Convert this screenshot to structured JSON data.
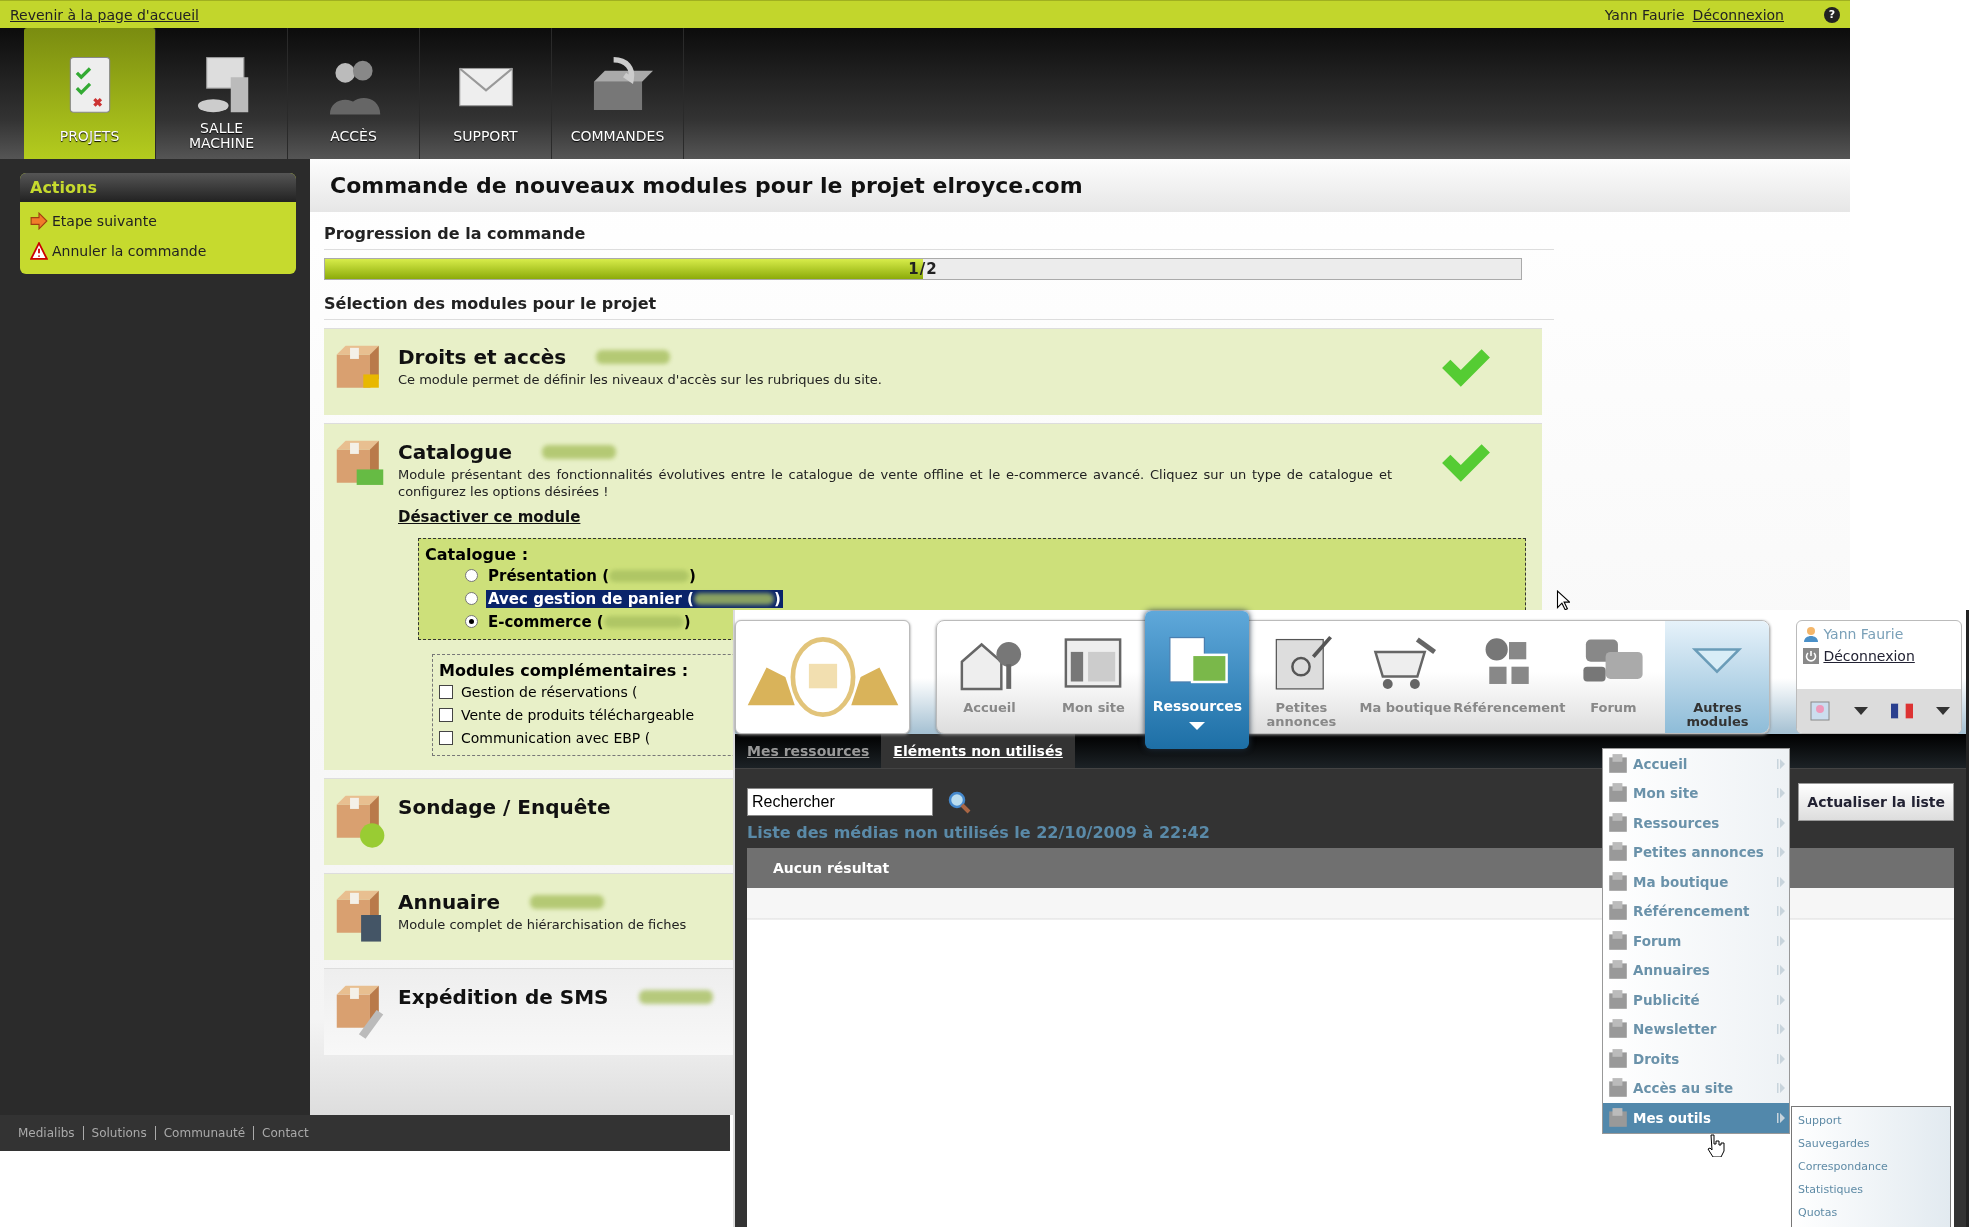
{
  "back": {
    "top_bar": {
      "home_link": "Revenir à la page d'accueil",
      "user": "Yann Faurie",
      "logout": "Déconnexion",
      "help": "?"
    },
    "nav": [
      {
        "label": "PROJETS",
        "selected": true
      },
      {
        "label": "SALLE MACHINE",
        "selected": false
      },
      {
        "label": "ACCÈS",
        "selected": false
      },
      {
        "label": "SUPPORT",
        "selected": false
      },
      {
        "label": "COMMANDES",
        "selected": false
      }
    ],
    "sidebar": {
      "title": "Actions",
      "items": [
        {
          "label": "Etape suivante",
          "kind": "next"
        },
        {
          "label": "Annuler la commande",
          "kind": "warning"
        }
      ]
    },
    "page_title": "Commande de nouveaux modules pour le projet elroyce.com",
    "progress": {
      "heading": "Progression de la commande",
      "label": "1/2",
      "level": 0.5
    },
    "modules_heading": "Sélection des modules pour le projet",
    "modules": [
      {
        "name": "Droits et accès",
        "description": "Ce module permet de définir les niveaux d'accès sur les rubriques du site.",
        "active": true
      },
      {
        "name": "Catalogue",
        "description": "Module présentant des fonctionnalités évolutives entre le catalogue de vente offline et le e-commerce avancé. Cliquez sur un type de catalogue et configurez les options désirées !",
        "active": true,
        "deactivate_link": "Désactiver ce module",
        "options": {
          "title": "Catalogue :",
          "items": [
            {
              "label": "Présentation (",
              "close": ")",
              "selected": false,
              "highlighted": false
            },
            {
              "label": "Avec gestion de panier (",
              "close": ")",
              "selected": false,
              "highlighted": true
            },
            {
              "label": "E-commerce (",
              "close": ")",
              "selected": true,
              "highlighted": false
            }
          ]
        },
        "extras": {
          "title": "Modules complémentaires :",
          "items": [
            {
              "label": "Gestion de réservations (",
              "checked": false
            },
            {
              "label": "Vente de produits téléchargeable",
              "checked": false
            },
            {
              "label": "Communication avec EBP (",
              "checked": false
            }
          ]
        }
      },
      {
        "name": "Sondage / Enquête",
        "active": false
      },
      {
        "name": "Annuaire",
        "description": "Module complet de hiérarchisation de fiches",
        "active": false
      },
      {
        "name": "Expédition de SMS",
        "active": false
      }
    ],
    "footer": [
      "Medialibs",
      "Solutions",
      "Communauté",
      "Contact"
    ]
  },
  "front": {
    "nav": [
      {
        "label": "Accueil",
        "kind": "module",
        "selected": false
      },
      {
        "label": "Mon site",
        "kind": "module",
        "selected": false
      },
      {
        "label": "Ressources",
        "kind": "module",
        "selected": true
      },
      {
        "label": "Petites annonces",
        "kind": "module",
        "selected": false
      },
      {
        "label": "Ma boutique",
        "kind": "module",
        "selected": false
      },
      {
        "label": "Référencement",
        "kind": "module",
        "selected": false
      },
      {
        "label": "Forum",
        "kind": "module",
        "selected": false
      },
      {
        "label": "Autres modules",
        "kind": "more",
        "selected": false
      }
    ],
    "user": {
      "name": "Yann Faurie",
      "logout": "Déconnexion"
    },
    "tabs": [
      {
        "label": "Mes ressources",
        "selected": false
      },
      {
        "label": "Eléments non utilisés",
        "selected": true
      }
    ],
    "search": {
      "value": "Rechercher"
    },
    "refresh_button": "Actualiser la liste",
    "list_title": "Liste des médias non utilisés le 22/10/2009 à 22:42",
    "table": {
      "header": "Aucun résultat"
    },
    "menu": [
      {
        "label": "Accueil",
        "selected": false
      },
      {
        "label": "Mon site",
        "selected": false
      },
      {
        "label": "Ressources",
        "selected": false
      },
      {
        "label": "Petites annonces",
        "selected": false
      },
      {
        "label": "Ma boutique",
        "selected": false
      },
      {
        "label": "Référencement",
        "selected": false
      },
      {
        "label": "Forum",
        "selected": false
      },
      {
        "label": "Annuaires",
        "selected": false
      },
      {
        "label": "Publicité",
        "selected": false
      },
      {
        "label": "Newsletter",
        "selected": false
      },
      {
        "label": "Droits",
        "selected": false
      },
      {
        "label": "Accès au site",
        "selected": false
      },
      {
        "label": "Mes outils",
        "selected": true
      }
    ],
    "submenu": [
      "Support",
      "Sauvegardes",
      "Correspondance",
      "Statistiques",
      "Quotas"
    ]
  }
}
